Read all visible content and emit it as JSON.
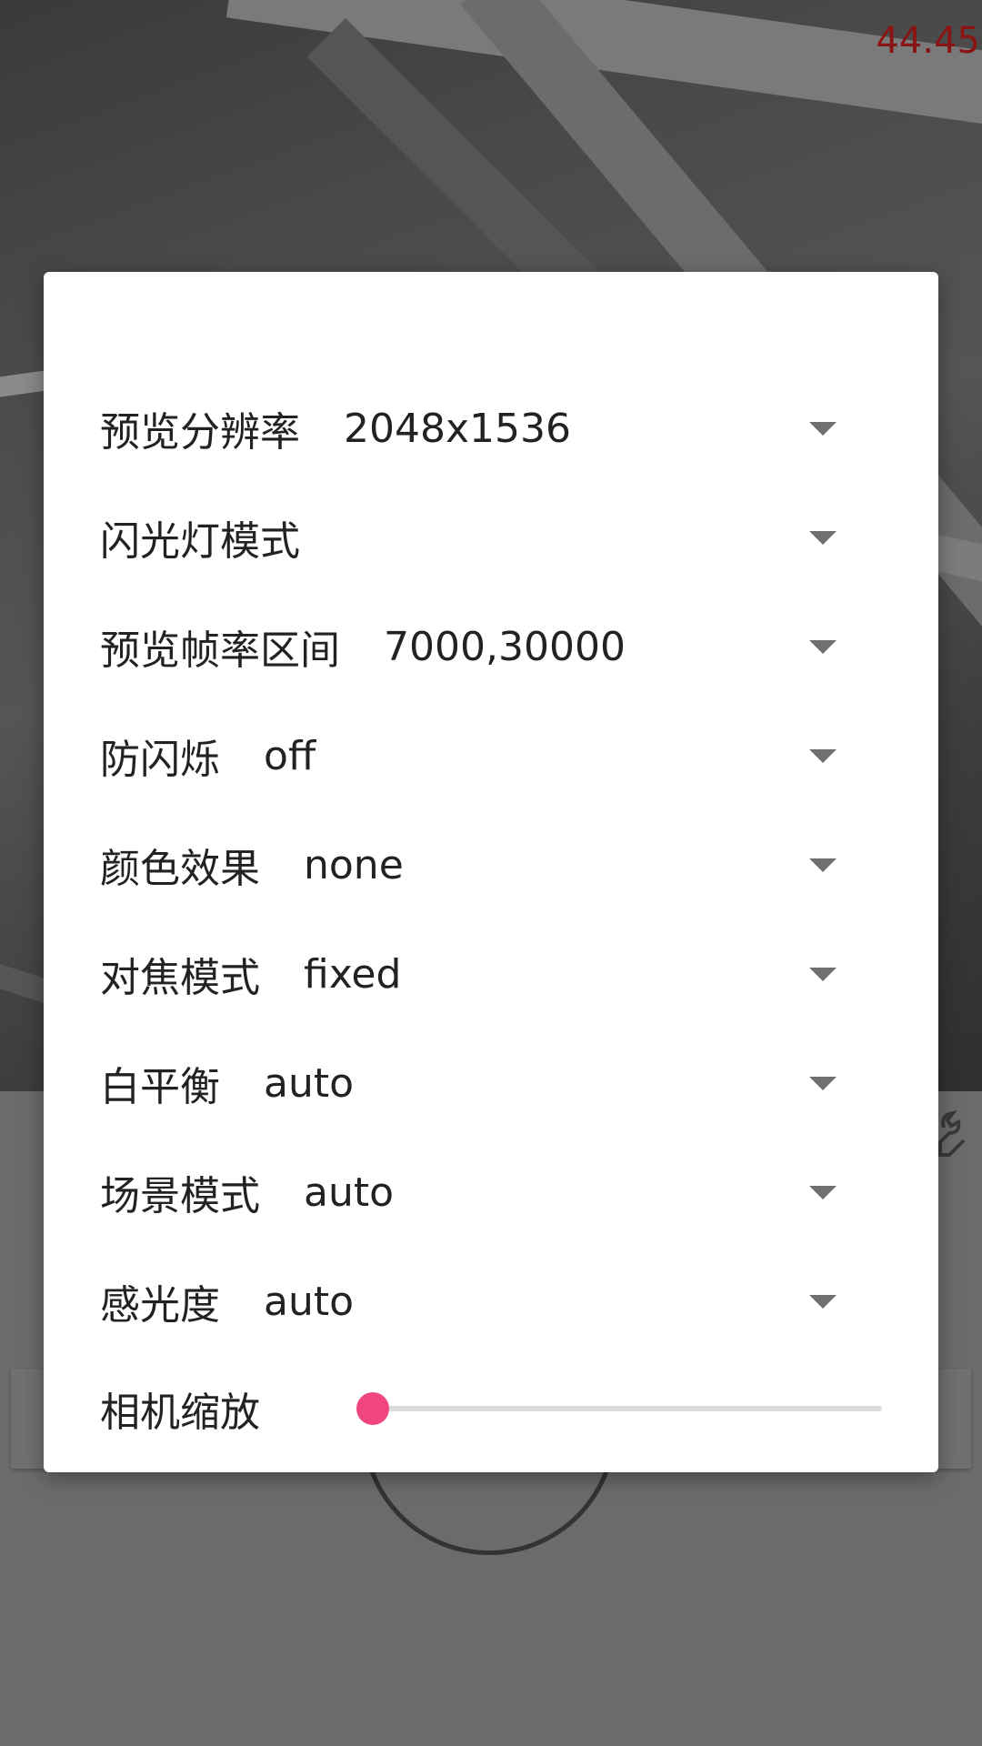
{
  "status": {
    "fps": "44.45"
  },
  "settings_dialog": {
    "rows": [
      {
        "label": "预览分辨率",
        "value": "2048x1536"
      },
      {
        "label": "闪光灯模式",
        "value": ""
      },
      {
        "label": "预览帧率区间",
        "value": "7000,30000"
      },
      {
        "label": "防闪烁",
        "value": "off"
      },
      {
        "label": "颜色效果",
        "value": "none"
      },
      {
        "label": "对焦模式",
        "value": "fixed"
      },
      {
        "label": "白平衡",
        "value": "auto"
      },
      {
        "label": "场景模式",
        "value": "auto"
      },
      {
        "label": "感光度",
        "value": "auto"
      }
    ],
    "zoom": {
      "label": "相机缩放",
      "level": 0
    }
  },
  "icons": {
    "dropdown": "triangle-down-icon",
    "settings": "wrench-icon"
  },
  "colors": {
    "accent": "#f0457e",
    "fps_text": "#8a1414",
    "dialog_bg": "#ffffff",
    "dropdown_arrow": "#707070"
  }
}
